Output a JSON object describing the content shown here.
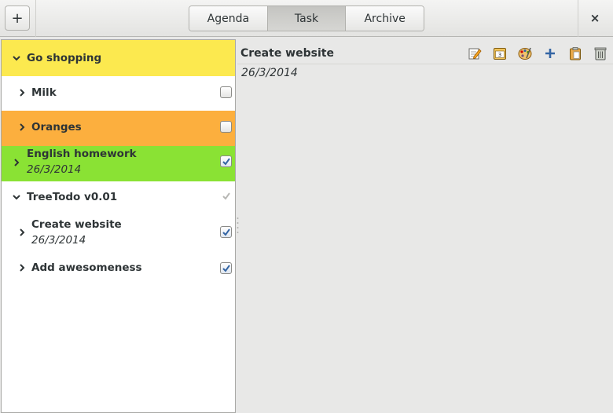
{
  "header": {
    "add_button": "+",
    "close_button": "×",
    "tabs": [
      {
        "label": "Agenda",
        "active": false
      },
      {
        "label": "Task",
        "active": true
      },
      {
        "label": "Archive",
        "active": false
      }
    ]
  },
  "tree": {
    "items": [
      {
        "label": "Go shopping",
        "date": "",
        "expanded": true,
        "level": 0,
        "background": "#fce94f",
        "check": "none"
      },
      {
        "label": "Milk",
        "date": "",
        "expanded": false,
        "level": 1,
        "background": "#ffffff",
        "check": "unchecked"
      },
      {
        "label": "Oranges",
        "date": "",
        "expanded": false,
        "level": 1,
        "background": "#fcaf3e",
        "check": "unchecked"
      },
      {
        "label": "English homework",
        "date": "26/3/2014",
        "expanded": false,
        "level": 0,
        "background": "#8ae234",
        "check": "checked"
      },
      {
        "label": "TreeTodo v0.01",
        "date": "",
        "expanded": true,
        "level": 0,
        "background": "#ffffff",
        "check": "mark"
      },
      {
        "label": "Create website",
        "date": "26/3/2014",
        "expanded": false,
        "level": 1,
        "background": "#ffffff",
        "check": "checked"
      },
      {
        "label": "Add awesomeness",
        "date": "",
        "expanded": false,
        "level": 1,
        "background": "#ffffff",
        "check": "checked"
      }
    ]
  },
  "detail": {
    "title": "Create website",
    "date": "26/3/2014",
    "toolbar": [
      "edit-icon",
      "calendar-icon",
      "color-palette-icon",
      "add-icon",
      "paste-icon",
      "trash-icon"
    ]
  }
}
